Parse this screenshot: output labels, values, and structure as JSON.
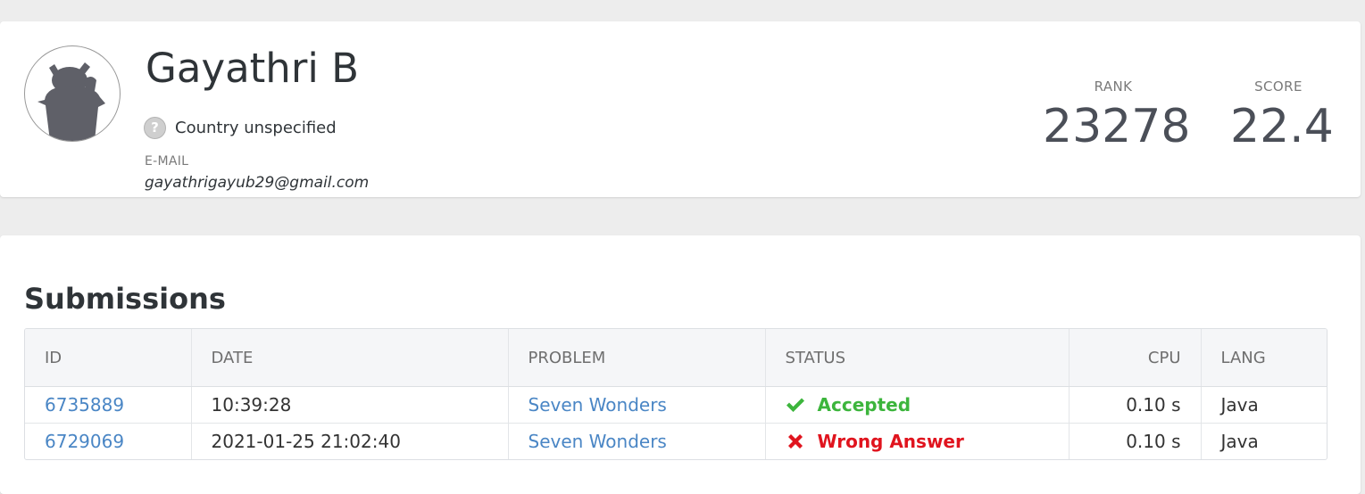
{
  "profile": {
    "name": "Gayathri B",
    "country": "Country unspecified",
    "country_icon": "question-mark-icon",
    "email_label": "E-MAIL",
    "email": "gayathrigayub29@gmail.com",
    "rank_label": "RANK",
    "rank": "23278",
    "score_label": "SCORE",
    "score": "22.4"
  },
  "submissions": {
    "title": "Submissions",
    "columns": {
      "id": "ID",
      "date": "DATE",
      "problem": "PROBLEM",
      "status": "STATUS",
      "cpu": "CPU",
      "lang": "LANG"
    },
    "rows": [
      {
        "id": "6735889",
        "date": "10:39:28",
        "problem": "Seven Wonders",
        "status": "Accepted",
        "status_icon": "check-icon",
        "status_color": "#3cb53c",
        "cpu": "0.10 s",
        "lang": "Java"
      },
      {
        "id": "6729069",
        "date": "2021-01-25 21:02:40",
        "problem": "Seven Wonders",
        "status": "Wrong Answer",
        "status_icon": "cross-icon",
        "status_color": "#e0141e",
        "cpu": "0.10 s",
        "lang": "Java"
      }
    ]
  }
}
